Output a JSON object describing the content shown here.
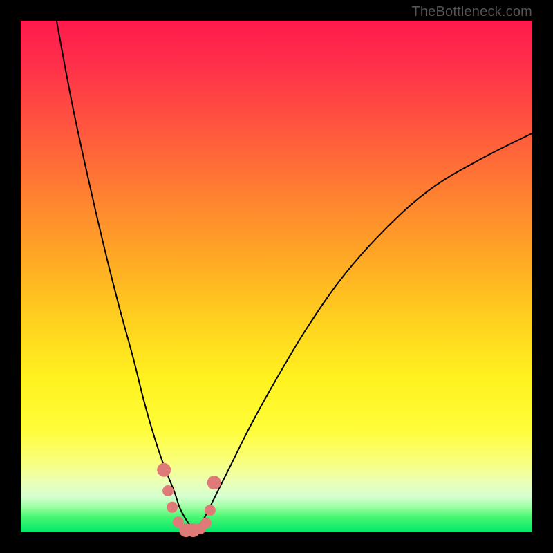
{
  "watermark": "TheBottleneck.com",
  "colors": {
    "frame_bg": "#000000",
    "gradient_top": "#ff1a4d",
    "gradient_bottom": "#00e86a",
    "curve": "#000000",
    "marker": "#e07a78"
  },
  "chart_data": {
    "type": "line",
    "title": "",
    "xlabel": "",
    "ylabel": "",
    "x_range": [
      0,
      100
    ],
    "y_range": [
      0,
      100
    ],
    "legend": false,
    "grid": false,
    "background": "red-yellow-green vertical gradient",
    "series": [
      {
        "name": "left-branch",
        "x": [
          7,
          10,
          13,
          16,
          19,
          22,
          24,
          26,
          28,
          30,
          31,
          32,
          34
        ],
        "y": [
          100,
          84,
          70,
          57,
          45,
          34,
          26,
          19,
          13,
          8,
          5,
          3,
          0
        ]
      },
      {
        "name": "right-branch",
        "x": [
          34,
          36,
          38,
          41,
          45,
          50,
          56,
          63,
          71,
          80,
          90,
          100
        ],
        "y": [
          0,
          3,
          7,
          13,
          21,
          30,
          40,
          50,
          59,
          67,
          73,
          78
        ]
      }
    ],
    "markers": {
      "name": "notch-dots",
      "x": [
        28.0,
        28.8,
        29.6,
        30.8,
        32.3,
        33.7,
        35.1,
        36.2,
        37.0,
        37.8
      ],
      "y": [
        12.2,
        8.1,
        4.9,
        2.0,
        0.4,
        0.4,
        0.7,
        1.8,
        4.3,
        9.7
      ],
      "size": [
        "lg",
        "md",
        "md",
        "md",
        "lg",
        "lg",
        "md",
        "md",
        "md",
        "lg"
      ]
    },
    "minimum_at_x": 33
  }
}
